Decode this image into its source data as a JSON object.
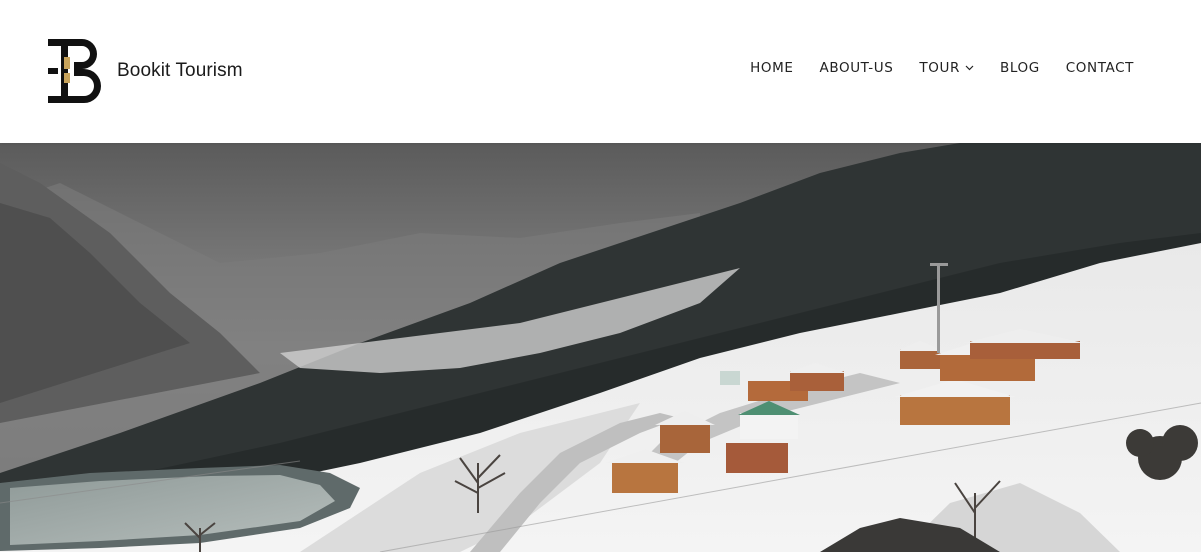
{
  "brand": {
    "name": "Bookit Tourism",
    "logo_icon": "bookit-b-logo-icon",
    "accent_color": "#c8a45c"
  },
  "nav": {
    "items": [
      {
        "label": "HOME"
      },
      {
        "label": "ABOUT-US"
      },
      {
        "label": "TOUR",
        "icon": "chevron-down-icon"
      },
      {
        "label": "BLOG"
      },
      {
        "label": "CONTACT"
      }
    ]
  },
  "hero": {
    "image": "snowy-mountain-resort-photo"
  }
}
